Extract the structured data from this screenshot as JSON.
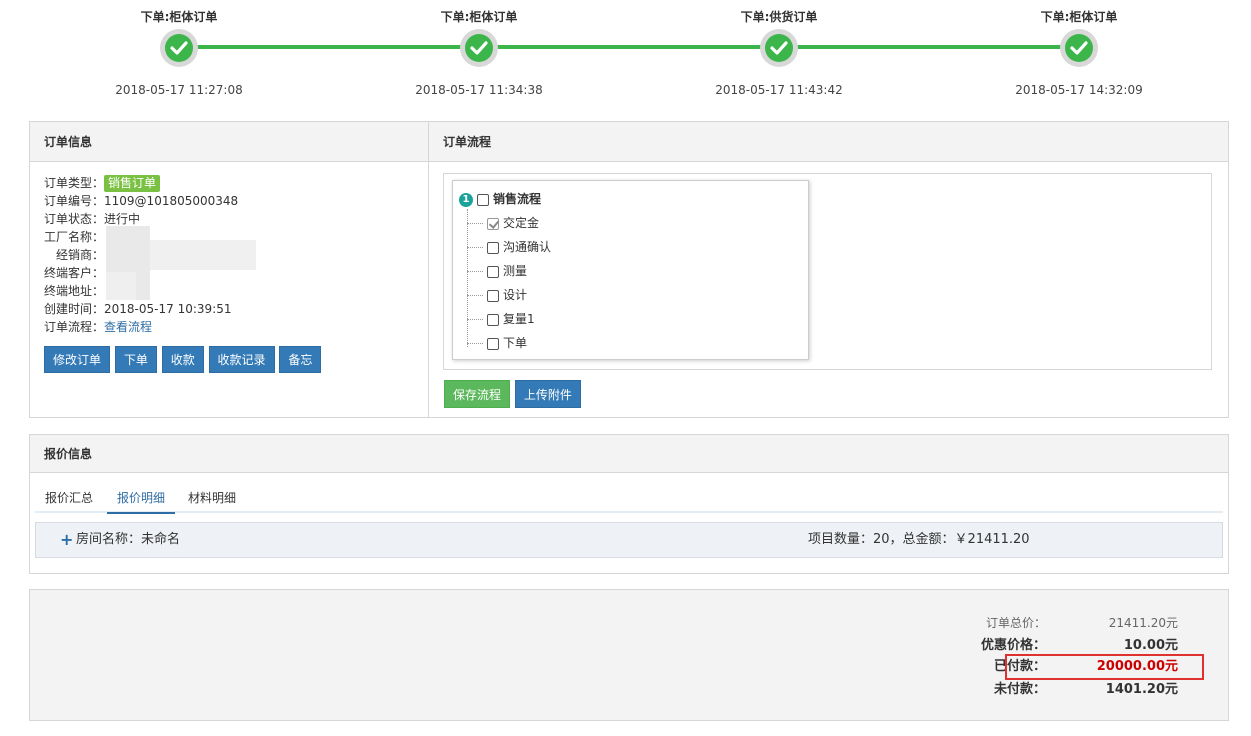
{
  "steps": [
    {
      "title": "下单:柜体订单",
      "time": "2018-05-17 11:27:08"
    },
    {
      "title": "下单:柜体订单",
      "time": "2018-05-17 11:34:38"
    },
    {
      "title": "下单:供货订单",
      "time": "2018-05-17 11:43:42"
    },
    {
      "title": "下单:柜体订单",
      "time": "2018-05-17 14:32:09"
    }
  ],
  "order_info": {
    "heading": "订单信息",
    "type_label": "订单类型：",
    "type_value": "销售订单",
    "number_label": "订单编号：",
    "number_value": "1109@101805000348",
    "status_label": "订单状态：",
    "status_value": "进行中",
    "factory_label": "工厂名称：",
    "dealer_label": "经销商：",
    "client_label": "终端客户：",
    "address_label": "终端地址：",
    "created_label": "创建时间：",
    "created_value": "2018-05-17 10:39:51",
    "flow_label": "订单流程：",
    "flow_link": "查看流程",
    "buttons": {
      "modify": "修改订单",
      "place": "下单",
      "collect": "收款",
      "records": "收款记录",
      "memo": "备忘"
    }
  },
  "order_flow": {
    "heading": "订单流程",
    "root_num": "1",
    "root_label": "销售流程",
    "items": [
      {
        "label": "交定金",
        "checked": true
      },
      {
        "label": "沟通确认",
        "checked": false
      },
      {
        "label": "测量",
        "checked": false
      },
      {
        "label": "设计",
        "checked": false
      },
      {
        "label": "复量1",
        "checked": false
      },
      {
        "label": "下单",
        "checked": false
      }
    ],
    "save_label": "保存流程",
    "upload_label": "上传附件"
  },
  "quote": {
    "heading": "报价信息",
    "tabs": [
      "报价汇总",
      "报价明细",
      "材料明细"
    ],
    "active_tab": "报价明细",
    "room_label": "房间名称：未命名",
    "summary": "项目数量：20，总金额：￥21411.20"
  },
  "totals": {
    "total_label": "订单总价：",
    "total_value": "21411.20元",
    "discount_label": "优惠价格：",
    "discount_value": "10.00元",
    "paid_label": "已付款：",
    "paid_value": "20000.00元",
    "unpaid_label": "未付款：",
    "unpaid_value": "1401.20元"
  },
  "colors": {
    "step_green": "#3cb54a",
    "primary_blue": "#337ab7",
    "success_green": "#5cb85c",
    "badge_green": "#7ac143",
    "paid_red": "#cc0000",
    "highlight_border": "#e03030"
  }
}
